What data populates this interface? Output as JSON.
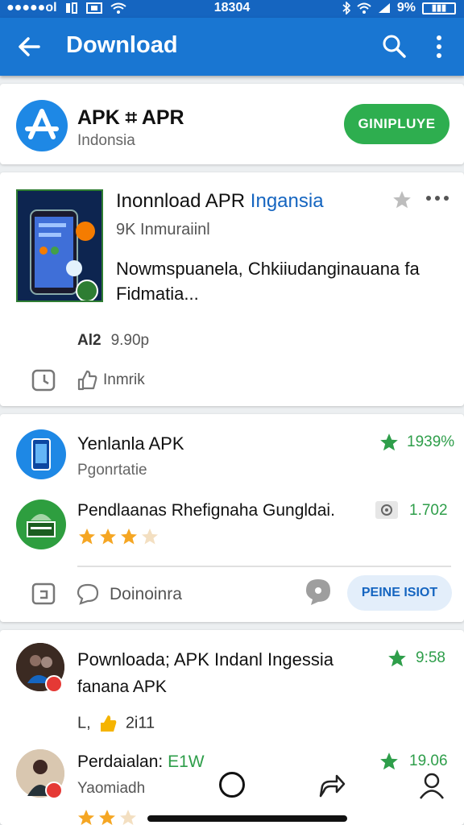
{
  "status_bar": {
    "carrier": "●●●●●ol",
    "time": "18304",
    "battery": "9%"
  },
  "app_bar": {
    "title": "Download"
  },
  "featured": {
    "name": "APK ⌗ APR",
    "subtitle": "Indonsia",
    "button": "GINIPLUYE"
  },
  "post": {
    "title_main": "Inonnload APR ",
    "title_accent": "Ingansia",
    "subtitle": "9K Inmuraiinl",
    "description": "Nowmspuanela, Chkiiudanginauana fa Fidmatia...",
    "meta_label": "Al2",
    "meta_value": "9.90p",
    "action": "Inmrik"
  },
  "list1": {
    "item1_name": "Yenlanla APK",
    "item1_sub": "Pgonrtatie",
    "item1_rating": "1939%",
    "item2_name": "Pendlaanas Rhefignaha Gungldai.",
    "item2_rating": "1.702",
    "action": "Doinoinra",
    "pill": "PEINE ISIOT",
    "item2_stars": 3.5
  },
  "list2": {
    "item1_name": "Pownloada; APK Indanl Ingessia",
    "item1_line2": "fanana APK",
    "item1_rating": "9:58",
    "item1_meta_prefix": "L,",
    "item1_meta_value": "2i11",
    "item2_name_prefix": "Perdaialan: ",
    "item2_name_accent": "E1W",
    "item2_sub": "Yaomiadh",
    "item2_rating": "19.06",
    "item2_stars": 2.5
  },
  "colors": {
    "primary": "#1976d2",
    "accent_green": "#2eae4f",
    "star": "#f5a623"
  }
}
